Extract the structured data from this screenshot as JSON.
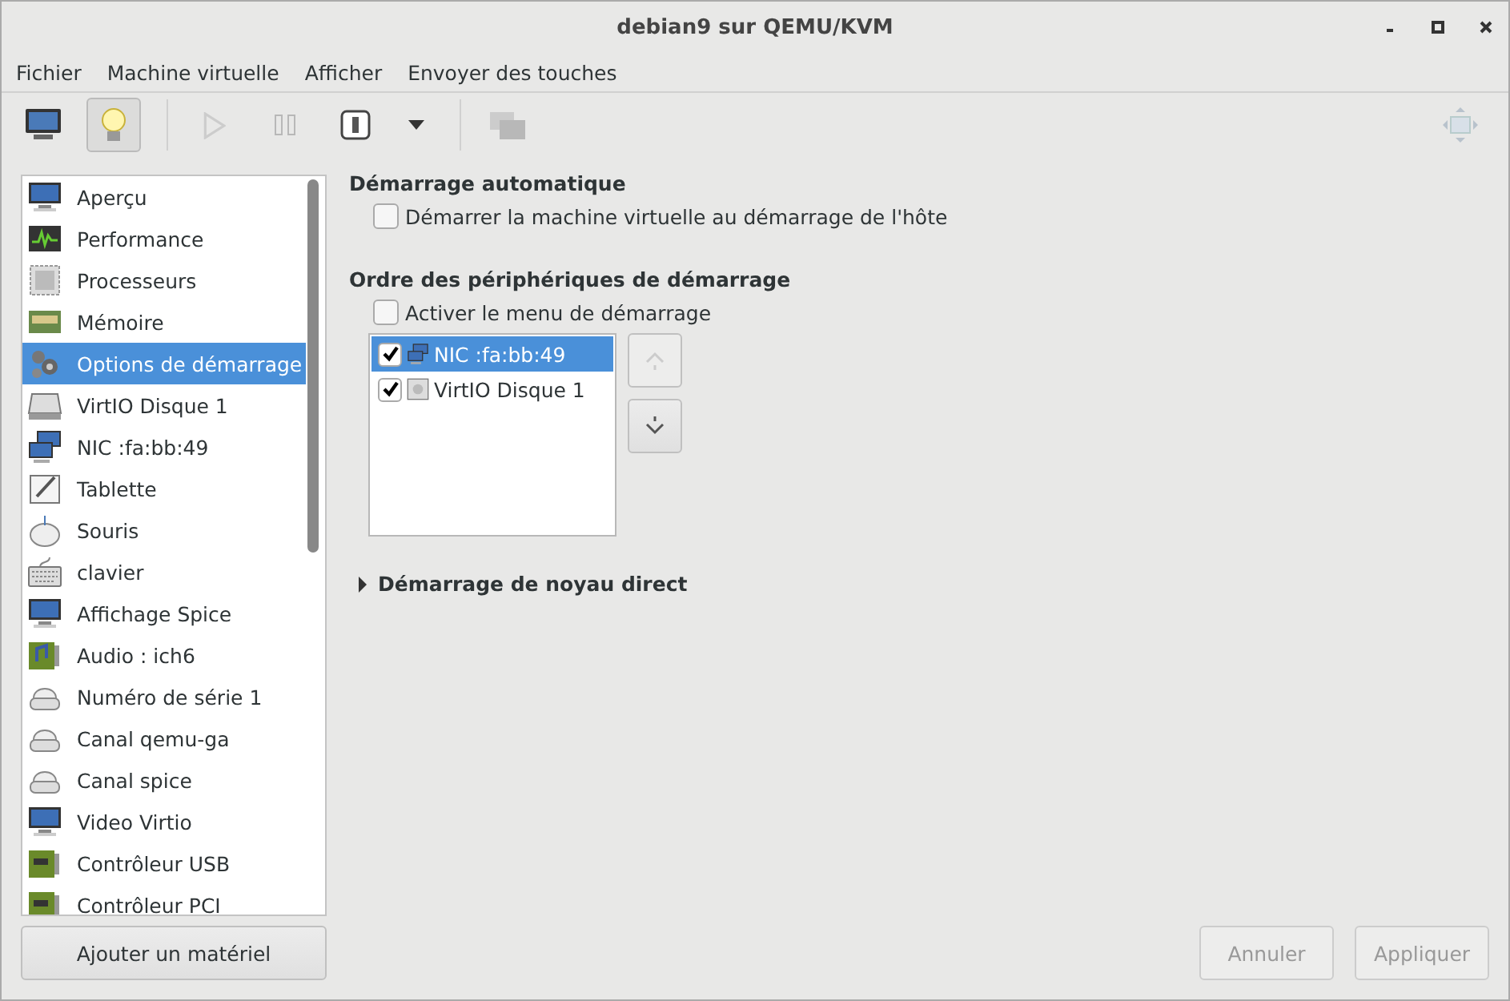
{
  "window": {
    "title": "debian9 sur QEMU/KVM"
  },
  "menu": [
    "Fichier",
    "Machine virtuelle",
    "Afficher",
    "Envoyer des touches"
  ],
  "toolbar": [
    {
      "kind": "monitor",
      "selected": false,
      "disabled": false
    },
    {
      "kind": "bulb",
      "selected": true,
      "disabled": false
    },
    {
      "kind": "sep"
    },
    {
      "kind": "play",
      "selected": false,
      "disabled": true
    },
    {
      "kind": "pause",
      "selected": false,
      "disabled": true
    },
    {
      "kind": "power",
      "selected": false,
      "disabled": false
    },
    {
      "kind": "caret",
      "selected": false,
      "disabled": false
    },
    {
      "kind": "sep"
    },
    {
      "kind": "screens",
      "selected": false,
      "disabled": true
    },
    {
      "kind": "fullscreen",
      "selected": false,
      "disabled": true
    }
  ],
  "sidebar": {
    "items": [
      {
        "label": "Aperçu",
        "kind": "monitor",
        "selected": false
      },
      {
        "label": "Performance",
        "kind": "chart",
        "selected": false
      },
      {
        "label": "Processeurs",
        "kind": "chip",
        "selected": false
      },
      {
        "label": "Mémoire",
        "kind": "ram",
        "selected": false
      },
      {
        "label": "Options de démarrage",
        "kind": "gears",
        "selected": true
      },
      {
        "label": "VirtIO Disque 1",
        "kind": "disk",
        "selected": false
      },
      {
        "label": "NIC :fa:bb:49",
        "kind": "network",
        "selected": false
      },
      {
        "label": "Tablette",
        "kind": "tablet",
        "selected": false
      },
      {
        "label": "Souris",
        "kind": "mouse",
        "selected": false
      },
      {
        "label": "clavier",
        "kind": "keyboard",
        "selected": false
      },
      {
        "label": "Affichage Spice",
        "kind": "monitor",
        "selected": false
      },
      {
        "label": "Audio : ich6",
        "kind": "audio",
        "selected": false
      },
      {
        "label": "Numéro de série 1",
        "kind": "serial",
        "selected": false
      },
      {
        "label": "Canal qemu-ga",
        "kind": "serial",
        "selected": false
      },
      {
        "label": "Canal spice",
        "kind": "serial",
        "selected": false
      },
      {
        "label": "Video Virtio",
        "kind": "monitor",
        "selected": false
      },
      {
        "label": "Contrôleur USB",
        "kind": "card",
        "selected": false
      },
      {
        "label": "Contrôleur PCI",
        "kind": "card",
        "selected": false
      }
    ],
    "add_button": "Ajouter un matériel"
  },
  "autostart": {
    "heading": "Démarrage automatique",
    "checkbox": {
      "label": "Démarrer la machine virtuelle au démarrage de l'hôte",
      "checked": false
    }
  },
  "boot_order": {
    "heading": "Ordre des périphériques de démarrage",
    "menu_checkbox": {
      "label": "Activer le menu de démarrage",
      "checked": false
    },
    "devices": [
      {
        "label": "NIC :fa:bb:49",
        "kind": "network",
        "checked": true,
        "selected": true
      },
      {
        "label": "VirtIO Disque 1",
        "kind": "disk",
        "checked": true,
        "selected": false
      }
    ],
    "move_up": {
      "disabled": true
    },
    "move_down": {
      "disabled": false
    }
  },
  "direct_kernel": {
    "label": "Démarrage de noyau direct",
    "expanded": false
  },
  "buttons": [
    {
      "label": "Annuler",
      "disabled": true
    },
    {
      "label": "Appliquer",
      "disabled": true
    }
  ]
}
